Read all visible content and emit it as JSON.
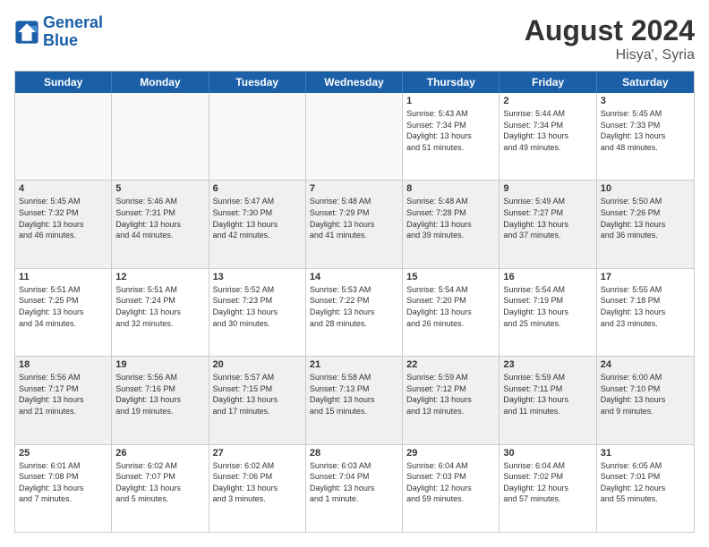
{
  "logo": {
    "line1": "General",
    "line2": "Blue"
  },
  "title": "August 2024",
  "location": "Hisya', Syria",
  "days_of_week": [
    "Sunday",
    "Monday",
    "Tuesday",
    "Wednesday",
    "Thursday",
    "Friday",
    "Saturday"
  ],
  "weeks": [
    [
      {
        "day": "",
        "info": ""
      },
      {
        "day": "",
        "info": ""
      },
      {
        "day": "",
        "info": ""
      },
      {
        "day": "",
        "info": ""
      },
      {
        "day": "1",
        "info": "Sunrise: 5:43 AM\nSunset: 7:34 PM\nDaylight: 13 hours\nand 51 minutes."
      },
      {
        "day": "2",
        "info": "Sunrise: 5:44 AM\nSunset: 7:34 PM\nDaylight: 13 hours\nand 49 minutes."
      },
      {
        "day": "3",
        "info": "Sunrise: 5:45 AM\nSunset: 7:33 PM\nDaylight: 13 hours\nand 48 minutes."
      }
    ],
    [
      {
        "day": "4",
        "info": "Sunrise: 5:45 AM\nSunset: 7:32 PM\nDaylight: 13 hours\nand 46 minutes."
      },
      {
        "day": "5",
        "info": "Sunrise: 5:46 AM\nSunset: 7:31 PM\nDaylight: 13 hours\nand 44 minutes."
      },
      {
        "day": "6",
        "info": "Sunrise: 5:47 AM\nSunset: 7:30 PM\nDaylight: 13 hours\nand 42 minutes."
      },
      {
        "day": "7",
        "info": "Sunrise: 5:48 AM\nSunset: 7:29 PM\nDaylight: 13 hours\nand 41 minutes."
      },
      {
        "day": "8",
        "info": "Sunrise: 5:48 AM\nSunset: 7:28 PM\nDaylight: 13 hours\nand 39 minutes."
      },
      {
        "day": "9",
        "info": "Sunrise: 5:49 AM\nSunset: 7:27 PM\nDaylight: 13 hours\nand 37 minutes."
      },
      {
        "day": "10",
        "info": "Sunrise: 5:50 AM\nSunset: 7:26 PM\nDaylight: 13 hours\nand 36 minutes."
      }
    ],
    [
      {
        "day": "11",
        "info": "Sunrise: 5:51 AM\nSunset: 7:25 PM\nDaylight: 13 hours\nand 34 minutes."
      },
      {
        "day": "12",
        "info": "Sunrise: 5:51 AM\nSunset: 7:24 PM\nDaylight: 13 hours\nand 32 minutes."
      },
      {
        "day": "13",
        "info": "Sunrise: 5:52 AM\nSunset: 7:23 PM\nDaylight: 13 hours\nand 30 minutes."
      },
      {
        "day": "14",
        "info": "Sunrise: 5:53 AM\nSunset: 7:22 PM\nDaylight: 13 hours\nand 28 minutes."
      },
      {
        "day": "15",
        "info": "Sunrise: 5:54 AM\nSunset: 7:20 PM\nDaylight: 13 hours\nand 26 minutes."
      },
      {
        "day": "16",
        "info": "Sunrise: 5:54 AM\nSunset: 7:19 PM\nDaylight: 13 hours\nand 25 minutes."
      },
      {
        "day": "17",
        "info": "Sunrise: 5:55 AM\nSunset: 7:18 PM\nDaylight: 13 hours\nand 23 minutes."
      }
    ],
    [
      {
        "day": "18",
        "info": "Sunrise: 5:56 AM\nSunset: 7:17 PM\nDaylight: 13 hours\nand 21 minutes."
      },
      {
        "day": "19",
        "info": "Sunrise: 5:56 AM\nSunset: 7:16 PM\nDaylight: 13 hours\nand 19 minutes."
      },
      {
        "day": "20",
        "info": "Sunrise: 5:57 AM\nSunset: 7:15 PM\nDaylight: 13 hours\nand 17 minutes."
      },
      {
        "day": "21",
        "info": "Sunrise: 5:58 AM\nSunset: 7:13 PM\nDaylight: 13 hours\nand 15 minutes."
      },
      {
        "day": "22",
        "info": "Sunrise: 5:59 AM\nSunset: 7:12 PM\nDaylight: 13 hours\nand 13 minutes."
      },
      {
        "day": "23",
        "info": "Sunrise: 5:59 AM\nSunset: 7:11 PM\nDaylight: 13 hours\nand 11 minutes."
      },
      {
        "day": "24",
        "info": "Sunrise: 6:00 AM\nSunset: 7:10 PM\nDaylight: 13 hours\nand 9 minutes."
      }
    ],
    [
      {
        "day": "25",
        "info": "Sunrise: 6:01 AM\nSunset: 7:08 PM\nDaylight: 13 hours\nand 7 minutes."
      },
      {
        "day": "26",
        "info": "Sunrise: 6:02 AM\nSunset: 7:07 PM\nDaylight: 13 hours\nand 5 minutes."
      },
      {
        "day": "27",
        "info": "Sunrise: 6:02 AM\nSunset: 7:06 PM\nDaylight: 13 hours\nand 3 minutes."
      },
      {
        "day": "28",
        "info": "Sunrise: 6:03 AM\nSunset: 7:04 PM\nDaylight: 13 hours\nand 1 minute."
      },
      {
        "day": "29",
        "info": "Sunrise: 6:04 AM\nSunset: 7:03 PM\nDaylight: 12 hours\nand 59 minutes."
      },
      {
        "day": "30",
        "info": "Sunrise: 6:04 AM\nSunset: 7:02 PM\nDaylight: 12 hours\nand 57 minutes."
      },
      {
        "day": "31",
        "info": "Sunrise: 6:05 AM\nSunset: 7:01 PM\nDaylight: 12 hours\nand 55 minutes."
      }
    ]
  ]
}
